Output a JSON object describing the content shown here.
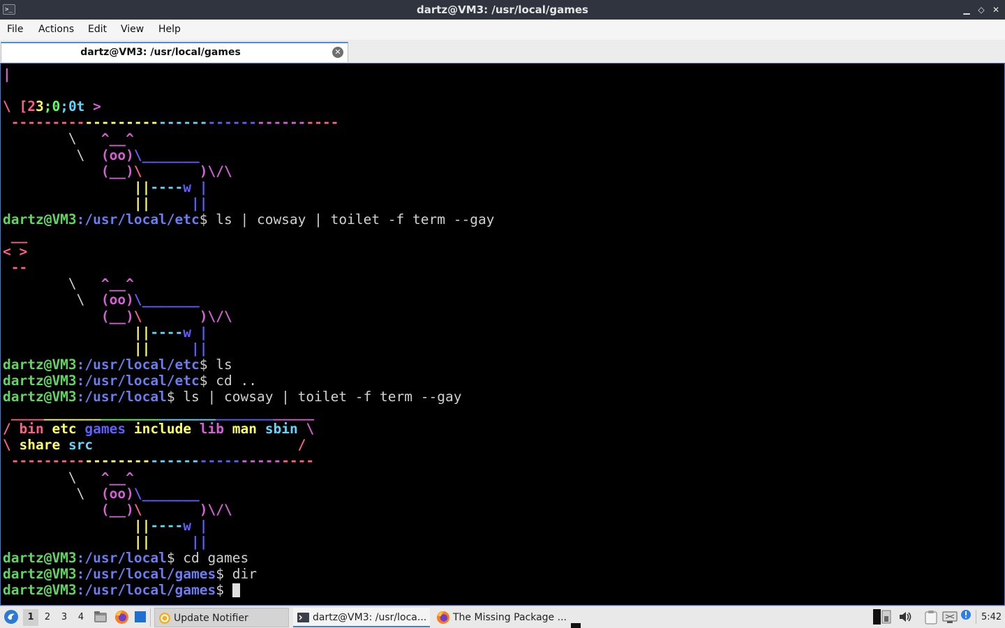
{
  "window": {
    "title": "dartz@VM3: /usr/local/games",
    "minimize_glyph": "▁",
    "restore_glyph": "◇",
    "close_glyph": "✕",
    "app_icon_glyph": ">_"
  },
  "menu": [
    "File",
    "Actions",
    "Edit",
    "View",
    "Help"
  ],
  "tab": {
    "label": "dartz@VM3: /usr/local/games",
    "close_glyph": "✕"
  },
  "colors": {
    "user": "#5fd75f",
    "path": "#6b7cf0",
    "text": "#d0d0d0",
    "red": "#ff5f87",
    "magenta": "#d75fd7",
    "blue": "#5f5fff",
    "cyan": "#5fd7ff",
    "green": "#5fff5f",
    "yellow": "#ffff5f"
  },
  "terminal_lines": [
    [
      [
        "|",
        "#d75fd7"
      ]
    ],
    [],
    [
      [
        "\\ ",
        "#ff5f87"
      ],
      [
        "[2",
        "#ff5f87"
      ],
      [
        "3",
        "#ffff5f"
      ],
      [
        ";0",
        "#5fff5f"
      ],
      [
        ";0t",
        "#5fd7ff"
      ],
      [
        " >",
        "#d75fd7"
      ]
    ],
    [
      [
        " ---------",
        "#ff5f87"
      ],
      [
        "---------",
        "#ffff5f"
      ],
      [
        "------",
        "#5fd7ff"
      ],
      [
        "------",
        "#5f5fff"
      ],
      [
        "------",
        "#d75fd7"
      ],
      [
        "----",
        "#ff5f87"
      ]
    ],
    [
      [
        "        \\   ",
        "#d0d0d0"
      ],
      [
        "^__^",
        "#d75fd7"
      ]
    ],
    [
      [
        "         \\  ",
        "#d0d0d0"
      ],
      [
        "(oo)",
        "#d75fd7"
      ],
      [
        "\\_______",
        "#5f5fff"
      ]
    ],
    [
      [
        "            ",
        "#d0d0d0"
      ],
      [
        "(__)",
        "#d75fd7"
      ],
      [
        "\\       ",
        "#ff5f87"
      ],
      [
        ")\\/\\",
        "#d75fd7"
      ]
    ],
    [
      [
        "                ",
        "#d0d0d0"
      ],
      [
        "||",
        "#ffff5f"
      ],
      [
        "----",
        "#5fd7ff"
      ],
      [
        "w |",
        "#5f5fff"
      ]
    ],
    [
      [
        "                ",
        "#d0d0d0"
      ],
      [
        "||",
        "#ffff5f"
      ],
      [
        "     ",
        "#d0d0d0"
      ],
      [
        "||",
        "#5f5fff"
      ]
    ],
    [
      [
        "dartz@VM3",
        "#5fd75f"
      ],
      [
        ":/usr/local/etc",
        "#6b7cf0"
      ],
      [
        "$ ls | cowsay | toilet -f term --gay",
        "#d0d0d0"
      ]
    ],
    [
      [
        " __",
        "#ff5f87"
      ]
    ],
    [
      [
        "< >",
        "#ff5f87"
      ]
    ],
    [
      [
        " --",
        "#ff5f87"
      ]
    ],
    [
      [
        "        \\   ",
        "#d0d0d0"
      ],
      [
        "^__^",
        "#d75fd7"
      ]
    ],
    [
      [
        "         \\  ",
        "#d0d0d0"
      ],
      [
        "(oo)",
        "#d75fd7"
      ],
      [
        "\\_______",
        "#5f5fff"
      ]
    ],
    [
      [
        "            ",
        "#d0d0d0"
      ],
      [
        "(__)",
        "#d75fd7"
      ],
      [
        "\\       ",
        "#ff5f87"
      ],
      [
        ")\\/\\",
        "#d75fd7"
      ]
    ],
    [
      [
        "                ",
        "#d0d0d0"
      ],
      [
        "||",
        "#ffff5f"
      ],
      [
        "----",
        "#5fd7ff"
      ],
      [
        "w |",
        "#5f5fff"
      ]
    ],
    [
      [
        "                ",
        "#d0d0d0"
      ],
      [
        "||",
        "#ffff5f"
      ],
      [
        "     ",
        "#d0d0d0"
      ],
      [
        "||",
        "#5f5fff"
      ]
    ],
    [
      [
        "dartz@VM3",
        "#5fd75f"
      ],
      [
        ":/usr/local/etc",
        "#6b7cf0"
      ],
      [
        "$ ls",
        "#d0d0d0"
      ]
    ],
    [
      [
        "dartz@VM3",
        "#5fd75f"
      ],
      [
        ":/usr/local/etc",
        "#6b7cf0"
      ],
      [
        "$ cd ..",
        "#d0d0d0"
      ]
    ],
    [
      [
        "dartz@VM3",
        "#5fd75f"
      ],
      [
        ":/usr/local",
        "#6b7cf0"
      ],
      [
        "$ ls | cowsay | toilet -f term --gay",
        "#d0d0d0"
      ]
    ],
    [
      [
        " ____",
        "#ff5f87"
      ],
      [
        "_______",
        "#ffff5f"
      ],
      [
        "_______",
        "#5fff5f"
      ],
      [
        "_______",
        "#5fd7ff"
      ],
      [
        "_______",
        "#5f5fff"
      ],
      [
        "_____",
        "#d75fd7"
      ]
    ],
    [
      [
        "/ ",
        "#ff5f87"
      ],
      [
        "bin ",
        "#ff5f87"
      ],
      [
        "etc ",
        "#ffff5f"
      ],
      [
        "games ",
        "#5f5fff"
      ],
      [
        "include ",
        "#ffff5f"
      ],
      [
        "lib ",
        "#d75fd7"
      ],
      [
        "man ",
        "#ffff5f"
      ],
      [
        "sbin ",
        "#5fd7ff"
      ],
      [
        "\\",
        "#d75fd7"
      ]
    ],
    [
      [
        "\\ ",
        "#ff5f87"
      ],
      [
        "share ",
        "#ffff5f"
      ],
      [
        "src",
        "#5fd7ff"
      ],
      [
        "                         ",
        "#d0d0d0"
      ],
      [
        "/",
        "#ff5f87"
      ]
    ],
    [
      [
        " ---------",
        "#ff5f87"
      ],
      [
        "--------",
        "#ffff5f"
      ],
      [
        "------",
        "#5fd7ff"
      ],
      [
        "-----",
        "#5f5fff"
      ],
      [
        "-----",
        "#d75fd7"
      ],
      [
        "----",
        "#ff5f87"
      ]
    ],
    [
      [
        "        \\   ",
        "#d0d0d0"
      ],
      [
        "^__^",
        "#d75fd7"
      ]
    ],
    [
      [
        "         \\  ",
        "#d0d0d0"
      ],
      [
        "(oo)",
        "#d75fd7"
      ],
      [
        "\\_______",
        "#5f5fff"
      ]
    ],
    [
      [
        "            ",
        "#d0d0d0"
      ],
      [
        "(__)",
        "#d75fd7"
      ],
      [
        "\\       ",
        "#ff5f87"
      ],
      [
        ")\\/\\",
        "#d75fd7"
      ]
    ],
    [
      [
        "                ",
        "#d0d0d0"
      ],
      [
        "||",
        "#ffff5f"
      ],
      [
        "----",
        "#5fd7ff"
      ],
      [
        "w |",
        "#5f5fff"
      ]
    ],
    [
      [
        "                ",
        "#d0d0d0"
      ],
      [
        "||",
        "#ffff5f"
      ],
      [
        "     ",
        "#d0d0d0"
      ],
      [
        "||",
        "#5f5fff"
      ]
    ],
    [
      [
        "dartz@VM3",
        "#5fd75f"
      ],
      [
        ":/usr/local",
        "#6b7cf0"
      ],
      [
        "$ cd games",
        "#d0d0d0"
      ]
    ],
    [
      [
        "dartz@VM3",
        "#5fd75f"
      ],
      [
        ":/usr/local/games",
        "#6b7cf0"
      ],
      [
        "$ dir",
        "#d0d0d0"
      ]
    ],
    [
      [
        "dartz@VM3",
        "#5fd75f"
      ],
      [
        ":/usr/local/games",
        "#6b7cf0"
      ],
      [
        "$ ",
        "#d0d0d0"
      ]
    ]
  ],
  "taskbar": {
    "workspaces": [
      "1",
      "2",
      "3",
      "4"
    ],
    "active_workspace": "1",
    "tasks": [
      {
        "label": "Update Notifier",
        "icon": "update-icon"
      },
      {
        "label": "dartz@VM3: /usr/loca...",
        "icon": "terminal-icon"
      },
      {
        "label": "The Missing Package ...",
        "icon": "firefox-icon"
      }
    ],
    "clock": "5:42"
  }
}
